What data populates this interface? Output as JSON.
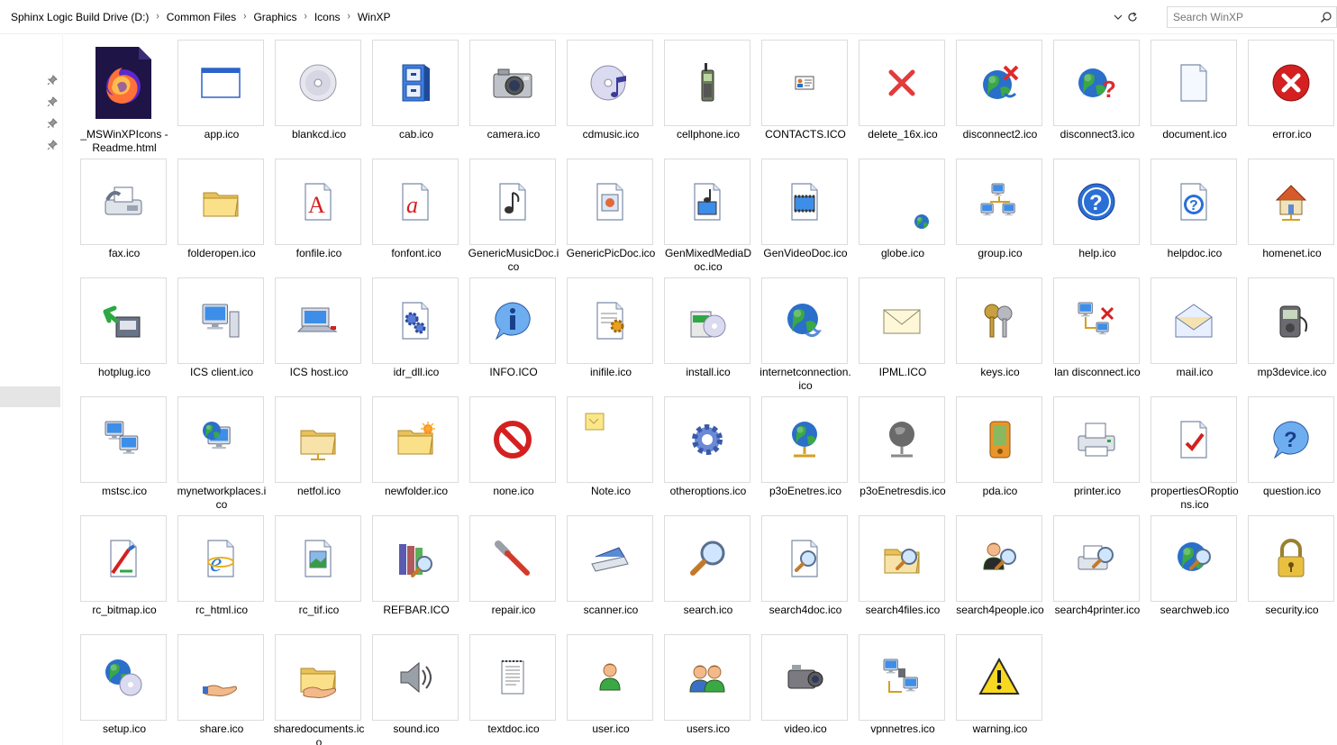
{
  "address": {
    "breadcrumbs": [
      "Sphinx Logic Build Drive (D:)",
      "Common Files",
      "Graphics",
      "Icons",
      "WinXP"
    ],
    "dropdown_icon": "chevron-down-icon",
    "refresh_icon": "refresh-icon"
  },
  "search": {
    "placeholder": "Search WinXP",
    "icon": "search-icon"
  },
  "navpane": {
    "pins": [
      "pin-icon",
      "pin-icon",
      "pin-icon",
      "pin-icon"
    ]
  },
  "colors": {
    "accent_blue": "#2b6fd6",
    "selection": "#e5e5e5",
    "thumb_border": "#dcdcdc"
  },
  "files": [
    {
      "name": "_MSWinXPIcons - Readme.html",
      "icon": "firefox-icon"
    },
    {
      "name": "app.ico",
      "icon": "app-window-icon"
    },
    {
      "name": "blankcd.ico",
      "icon": "cd-icon"
    },
    {
      "name": "cab.ico",
      "icon": "cabinet-icon"
    },
    {
      "name": "camera.ico",
      "icon": "camera-icon"
    },
    {
      "name": "cdmusic.ico",
      "icon": "cd-music-icon"
    },
    {
      "name": "cellphone.ico",
      "icon": "cellphone-icon"
    },
    {
      "name": "CONTACTS.ICO",
      "icon": "contacts-icon"
    },
    {
      "name": "delete_16x.ico",
      "icon": "delete-icon"
    },
    {
      "name": "disconnect2.ico",
      "icon": "globe-disconnect-icon"
    },
    {
      "name": "disconnect3.ico",
      "icon": "globe-question-icon"
    },
    {
      "name": "document.ico",
      "icon": "document-icon"
    },
    {
      "name": "error.ico",
      "icon": "error-icon"
    },
    {
      "name": "fax.ico",
      "icon": "fax-icon"
    },
    {
      "name": "folderopen.ico",
      "icon": "folder-open-icon"
    },
    {
      "name": "fonfile.ico",
      "icon": "font-file-icon"
    },
    {
      "name": "fonfont.ico",
      "icon": "font-italic-icon"
    },
    {
      "name": "GenericMusicDoc.ico",
      "icon": "music-doc-icon"
    },
    {
      "name": "GenericPicDoc.ico",
      "icon": "picture-doc-icon"
    },
    {
      "name": "GenMixedMediaDoc.ico",
      "icon": "mixed-media-doc-icon"
    },
    {
      "name": "GenVideoDoc.ico",
      "icon": "video-doc-icon"
    },
    {
      "name": "globe.ico",
      "icon": "globe-small-icon"
    },
    {
      "name": "group.ico",
      "icon": "network-group-icon"
    },
    {
      "name": "help.ico",
      "icon": "help-icon"
    },
    {
      "name": "helpdoc.ico",
      "icon": "help-doc-icon"
    },
    {
      "name": "homenet.ico",
      "icon": "home-network-icon"
    },
    {
      "name": "hotplug.ico",
      "icon": "hotplug-icon"
    },
    {
      "name": "ICS client.ico",
      "icon": "computer-icon"
    },
    {
      "name": "ICS host.ico",
      "icon": "laptop-icon"
    },
    {
      "name": "idr_dll.ico",
      "icon": "dll-gears-icon"
    },
    {
      "name": "INFO.ICO",
      "icon": "info-icon"
    },
    {
      "name": "inifile.ico",
      "icon": "ini-file-icon"
    },
    {
      "name": "install.ico",
      "icon": "install-icon"
    },
    {
      "name": "internetconnection.ico",
      "icon": "internet-connection-icon"
    },
    {
      "name": "IPML.ICO",
      "icon": "envelope-icon"
    },
    {
      "name": "keys.ico",
      "icon": "keys-icon"
    },
    {
      "name": "lan disconnect.ico",
      "icon": "lan-disconnect-icon"
    },
    {
      "name": "mail.ico",
      "icon": "mail-open-icon"
    },
    {
      "name": "mp3device.ico",
      "icon": "mp3-device-icon"
    },
    {
      "name": "mstsc.ico",
      "icon": "remote-desktop-icon"
    },
    {
      "name": "mynetworkplaces.ico",
      "icon": "network-places-icon"
    },
    {
      "name": "netfol.ico",
      "icon": "network-folder-icon"
    },
    {
      "name": "newfolder.ico",
      "icon": "new-folder-icon"
    },
    {
      "name": "none.ico",
      "icon": "no-entry-icon"
    },
    {
      "name": "Note.ico",
      "icon": "sticky-note-icon"
    },
    {
      "name": "otheroptions.ico",
      "icon": "gear-icon"
    },
    {
      "name": "p3oEnetres.ico",
      "icon": "globe-network-icon"
    },
    {
      "name": "p3oEnetresdis.ico",
      "icon": "globe-network-disabled-icon"
    },
    {
      "name": "pda.ico",
      "icon": "pda-icon"
    },
    {
      "name": "printer.ico",
      "icon": "printer-icon"
    },
    {
      "name": "propertiesORoptions.ico",
      "icon": "properties-icon"
    },
    {
      "name": "question.ico",
      "icon": "question-bubble-icon"
    },
    {
      "name": "rc_bitmap.ico",
      "icon": "bitmap-icon"
    },
    {
      "name": "rc_html.ico",
      "icon": "html-ie-icon"
    },
    {
      "name": "rc_tif.ico",
      "icon": "tif-icon"
    },
    {
      "name": "REFBAR.ICO",
      "icon": "refbar-icon"
    },
    {
      "name": "repair.ico",
      "icon": "wrench-icon"
    },
    {
      "name": "scanner.ico",
      "icon": "scanner-icon"
    },
    {
      "name": "search.ico",
      "icon": "magnifier-icon"
    },
    {
      "name": "search4doc.ico",
      "icon": "search-doc-icon"
    },
    {
      "name": "search4files.ico",
      "icon": "search-files-icon"
    },
    {
      "name": "search4people.ico",
      "icon": "search-people-icon"
    },
    {
      "name": "search4printer.ico",
      "icon": "search-printer-icon"
    },
    {
      "name": "searchweb.ico",
      "icon": "search-web-icon"
    },
    {
      "name": "security.ico",
      "icon": "padlock-icon"
    },
    {
      "name": "setup.ico",
      "icon": "setup-icon"
    },
    {
      "name": "share.ico",
      "icon": "share-hand-icon"
    },
    {
      "name": "sharedocuments.ico",
      "icon": "shared-folder-icon"
    },
    {
      "name": "sound.ico",
      "icon": "speaker-icon"
    },
    {
      "name": "textdoc.ico",
      "icon": "text-doc-icon"
    },
    {
      "name": "user.ico",
      "icon": "user-icon"
    },
    {
      "name": "users.ico",
      "icon": "users-icon"
    },
    {
      "name": "video.ico",
      "icon": "video-camera-icon"
    },
    {
      "name": "vpnnetres.ico",
      "icon": "vpn-icon"
    },
    {
      "name": "warning.ico",
      "icon": "warning-icon"
    }
  ]
}
